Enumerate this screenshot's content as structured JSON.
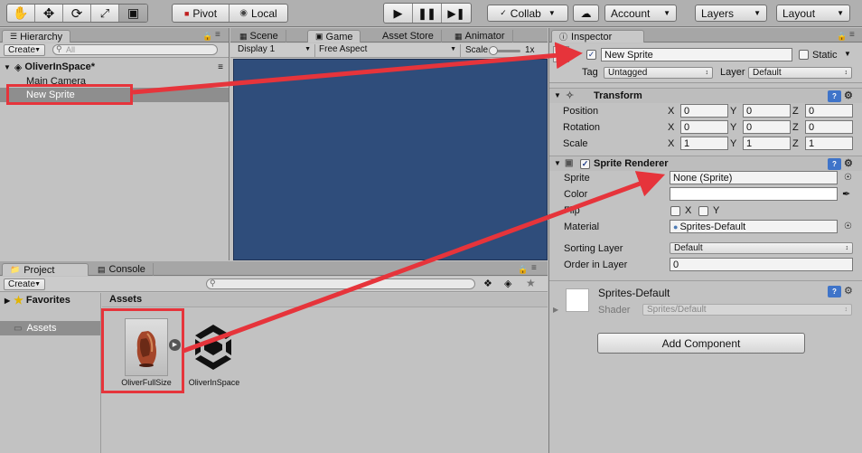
{
  "toolbar": {
    "pivot": "Pivot",
    "local": "Local",
    "collab": "Collab",
    "account": "Account",
    "layers": "Layers",
    "layout": "Layout"
  },
  "hierarchy": {
    "tab": "Hierarchy",
    "create": "Create",
    "search_placeholder": "All",
    "scene": "OliverInSpace*",
    "items": [
      "Main Camera",
      "New Sprite"
    ]
  },
  "scene_tabs": [
    "Scene",
    "Game",
    "Asset Store",
    "Animator"
  ],
  "game": {
    "display": "Display 1",
    "aspect": "Free Aspect",
    "scale_label": "Scale",
    "scale_value": "1x",
    "bg_color": "#2f4d7b"
  },
  "project": {
    "tabs": [
      "Project",
      "Console"
    ],
    "create": "Create",
    "favorites": "Favorites",
    "assets_folder": "Assets",
    "breadcrumb": "Assets",
    "assets": [
      "OliverFullSize",
      "OliverInSpace"
    ]
  },
  "inspector": {
    "tab": "Inspector",
    "name": "New Sprite",
    "static": "Static",
    "tag_label": "Tag",
    "tag_value": "Untagged",
    "layer_label": "Layer",
    "layer_value": "Default",
    "transform": {
      "title": "Transform",
      "rows": [
        {
          "label": "Position",
          "x": "0",
          "y": "0",
          "z": "0"
        },
        {
          "label": "Rotation",
          "x": "0",
          "y": "0",
          "z": "0"
        },
        {
          "label": "Scale",
          "x": "1",
          "y": "1",
          "z": "1"
        }
      ],
      "axis": [
        "X",
        "Y",
        "Z"
      ]
    },
    "sprite_renderer": {
      "title": "Sprite Renderer",
      "sprite_label": "Sprite",
      "sprite_value": "None (Sprite)",
      "color_label": "Color",
      "flip_label": "Flip",
      "flip_x": "X",
      "flip_y": "Y",
      "material_label": "Material",
      "material_value": "Sprites-Default",
      "sorting_label": "Sorting Layer",
      "sorting_value": "Default",
      "order_label": "Order in Layer",
      "order_value": "0"
    },
    "material": {
      "name": "Sprites-Default",
      "shader_label": "Shader",
      "shader_value": "Sprites/Default"
    },
    "add_component": "Add Component"
  },
  "colors": {
    "annotation": "#e6343b",
    "selection": "#8e8e8e"
  }
}
